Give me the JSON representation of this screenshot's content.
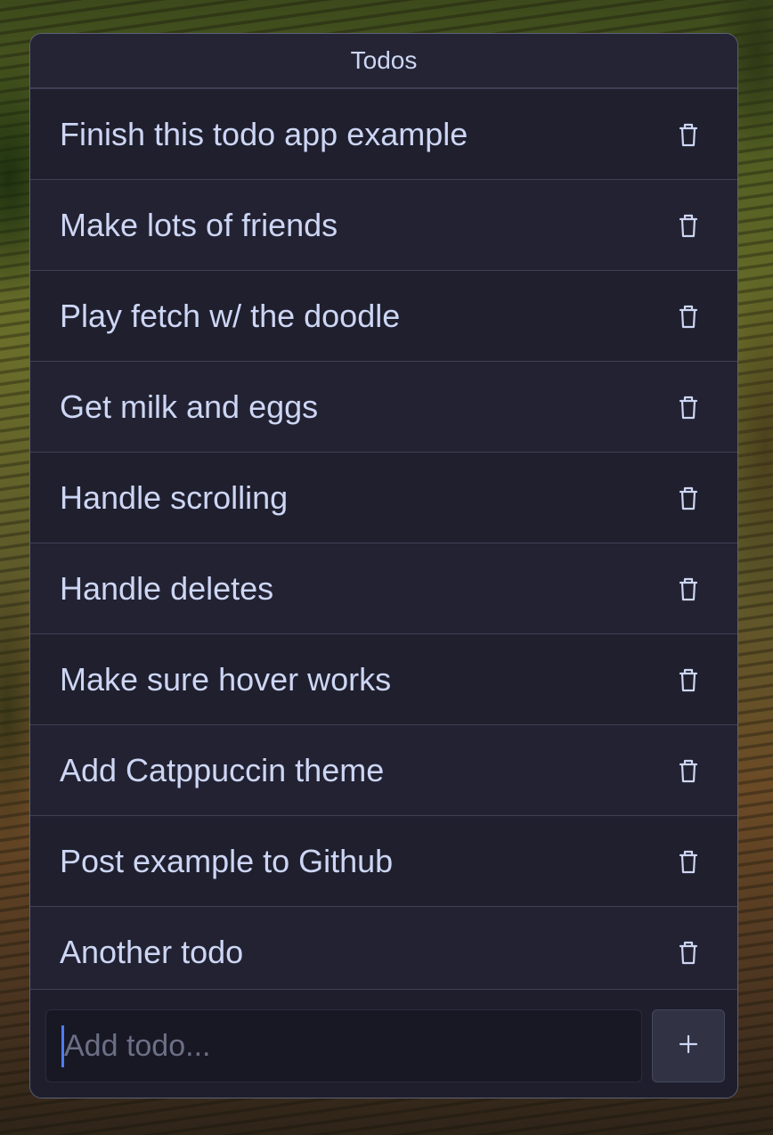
{
  "window": {
    "title": "Todos"
  },
  "todos": [
    {
      "text": "Finish this todo app example",
      "delete_icon": "trash-icon"
    },
    {
      "text": "Make lots of friends",
      "delete_icon": "trash-icon"
    },
    {
      "text": "Play fetch w/ the doodle",
      "delete_icon": "trash-icon"
    },
    {
      "text": "Get milk and eggs",
      "delete_icon": "trash-icon"
    },
    {
      "text": "Handle scrolling",
      "delete_icon": "trash-icon"
    },
    {
      "text": "Handle deletes",
      "delete_icon": "trash-icon"
    },
    {
      "text": "Make sure hover works",
      "delete_icon": "trash-icon"
    },
    {
      "text": "Add Catppuccin theme",
      "delete_icon": "trash-icon"
    },
    {
      "text": "Post example to Github",
      "delete_icon": "trash-icon"
    },
    {
      "text": "Another todo",
      "delete_icon": "trash-icon"
    }
  ],
  "add_form": {
    "value": "",
    "placeholder": "Add todo...",
    "button_icon": "plus-icon"
  },
  "theme": {
    "text": "#cdd6f4",
    "surface": "#1e1e2e",
    "border": "#45475a",
    "caret": "#4f7bff",
    "placeholder": "#6c7086"
  }
}
